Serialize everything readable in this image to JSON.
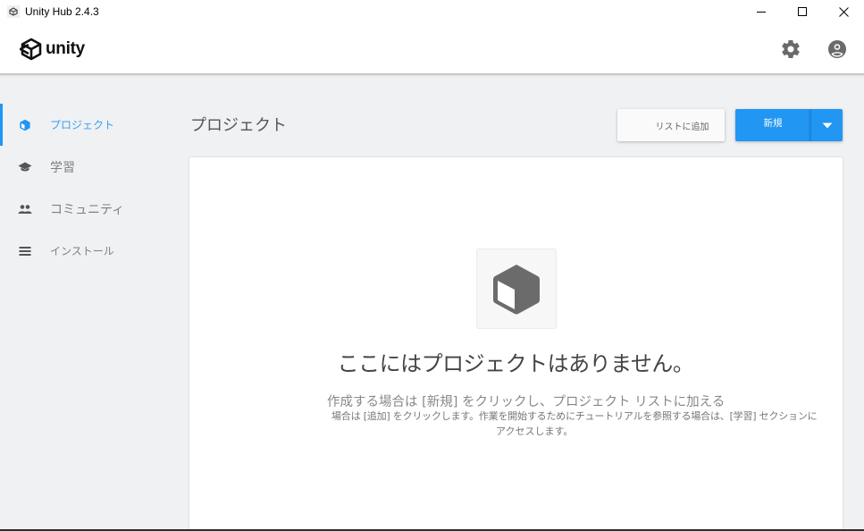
{
  "window": {
    "title": "Unity Hub 2.4.3",
    "controls": [
      "minimize",
      "maximize",
      "close"
    ]
  },
  "header": {
    "logo_text": "unity",
    "icons": [
      "gear-icon",
      "account-icon"
    ]
  },
  "sidebar": {
    "items": [
      {
        "label": "プロジェクト",
        "icon": "cube-icon",
        "active": true
      },
      {
        "label": "学習",
        "icon": "graduation-cap-icon",
        "active": false
      },
      {
        "label": "コミュニティ",
        "icon": "people-icon",
        "active": false
      },
      {
        "label": "インストール",
        "icon": "list-icon",
        "active": false
      }
    ]
  },
  "main": {
    "title": "プロジェクト",
    "add_button_label": "リストに追加",
    "new_button_label": "新規",
    "accent_color": "#2196f3",
    "empty_state": {
      "title": "ここにはプロジェクトはありません。",
      "line1": "作成する場合は [新規] をクリックし、プロジェクト リストに加える",
      "line2": "場合は [追加] をクリックします。作業を開始するためにチュートリアルを参照する場合は、[学習] セクションに",
      "line3": "アクセスします。"
    }
  }
}
